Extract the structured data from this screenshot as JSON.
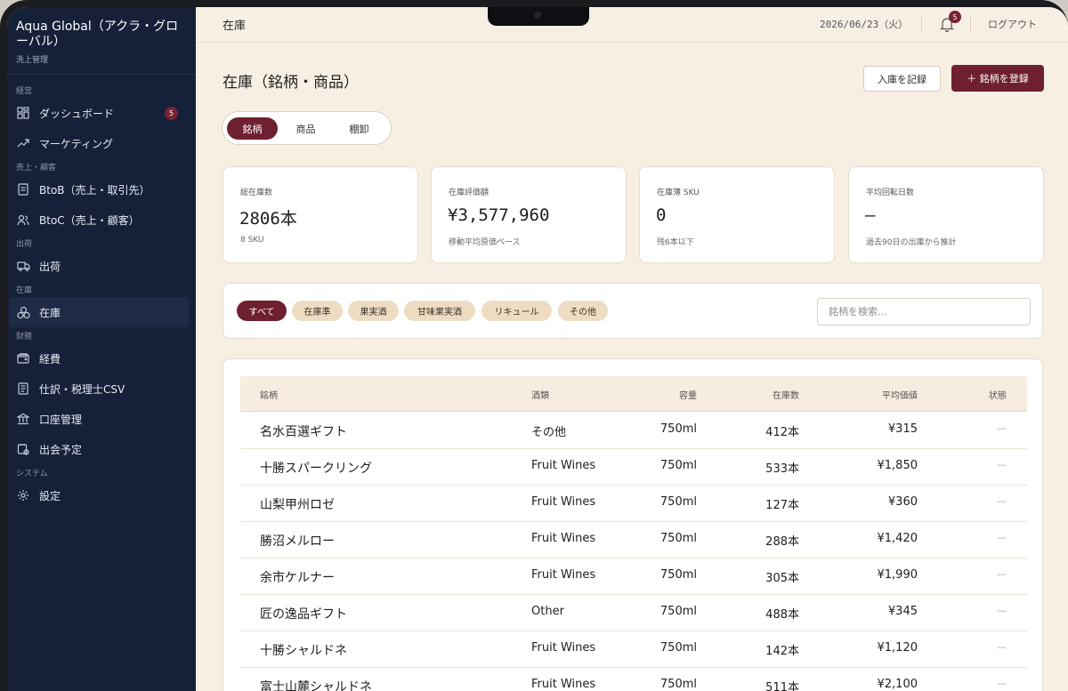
{
  "app": {
    "name": "Aqua Global（アクラ・グローバル）",
    "subtitle": "洗上管理"
  },
  "sidebar": {
    "sections": [
      {
        "label": "経営",
        "items": [
          {
            "label": "ダッシュボード",
            "icon": "grid-icon",
            "badge": "5"
          },
          {
            "label": "マーケティング",
            "icon": "trend-icon"
          }
        ]
      },
      {
        "label": "売上・顧客",
        "items": [
          {
            "label": "BtoB（売上・取引先）",
            "icon": "document-icon"
          },
          {
            "label": "BtoC（売上・顧客）",
            "icon": "users-icon"
          }
        ]
      },
      {
        "label": "出荷",
        "items": [
          {
            "label": "出荷",
            "icon": "truck-icon"
          }
        ]
      },
      {
        "label": "在庫",
        "items": [
          {
            "label": "在庫",
            "icon": "boxes-icon",
            "active": true
          }
        ]
      },
      {
        "label": "財務",
        "items": [
          {
            "label": "経費",
            "icon": "wallet-icon"
          },
          {
            "label": "仕訳・税理士CSV",
            "icon": "ledger-icon"
          },
          {
            "label": "口座管理",
            "icon": "bank-icon"
          },
          {
            "label": "出会予定",
            "icon": "calendar-check-icon"
          }
        ]
      },
      {
        "label": "システム",
        "items": [
          {
            "label": "設定",
            "icon": "gear-icon"
          }
        ]
      }
    ]
  },
  "header": {
    "title": "在庫",
    "date": "2026/06/23（火）",
    "notification_count": "5",
    "logout_label": "ログアウト"
  },
  "main": {
    "title": "在庫（銘柄・商品）",
    "record_button": "入庫を記録",
    "register_button": "＋ 銘柄を登録",
    "tabs": [
      "銘柄",
      "商品",
      "棚卸"
    ],
    "active_tab": "銘柄",
    "stats": [
      {
        "label": "総在庫数",
        "value": "2806本",
        "sub": "8 SKU"
      },
      {
        "label": "在庫評価額",
        "value": "¥3,577,960",
        "sub": "移動平均原価ベース"
      },
      {
        "label": "在庫薄 SKU",
        "value": "0",
        "sub": "残6本以下"
      },
      {
        "label": "平均回転日数",
        "value": "—",
        "sub": "過去90日の出庫から推計"
      }
    ],
    "filters": [
      "すべて",
      "在庫準",
      "果実酒",
      "甘味果実酒",
      "リキュール",
      "その他"
    ],
    "active_filter": "すべて",
    "search_placeholder": "銘柄を検索…",
    "table": {
      "columns": [
        "銘柄",
        "酒類",
        "容量",
        "在庫数",
        "平均価値",
        "状態"
      ],
      "rows": [
        {
          "name": "名水百選ギフト",
          "type": "その他",
          "volume": "750ml",
          "stock": "412本",
          "price": "¥315",
          "status": "—"
        },
        {
          "name": "十勝スパークリング",
          "type": "Fruit Wines",
          "volume": "750ml",
          "stock": "533本",
          "price": "¥1,850",
          "status": "—"
        },
        {
          "name": "山梨甲州ロゼ",
          "type": "Fruit Wines",
          "volume": "750ml",
          "stock": "127本",
          "price": "¥360",
          "status": "—"
        },
        {
          "name": "勝沼メルロー",
          "type": "Fruit Wines",
          "volume": "750ml",
          "stock": "288本",
          "price": "¥1,420",
          "status": "—"
        },
        {
          "name": "余市ケルナー",
          "type": "Fruit Wines",
          "volume": "750ml",
          "stock": "305本",
          "price": "¥1,990",
          "status": "—"
        },
        {
          "name": "匠の逸品ギフト",
          "type": "Other",
          "volume": "750ml",
          "stock": "488本",
          "price": "¥345",
          "status": "—"
        },
        {
          "name": "十勝シャルドネ",
          "type": "Fruit Wines",
          "volume": "750ml",
          "stock": "142本",
          "price": "¥1,120",
          "status": "—"
        },
        {
          "name": "富士山麓シャルドネ",
          "type": "Fruit Wines",
          "volume": "750ml",
          "stock": "511本",
          "price": "¥2,100",
          "status": "—"
        }
      ]
    }
  },
  "colors": {
    "accent": "#6e1f30",
    "sidebar_bg": "#162039",
    "page_bg": "#f8efe4",
    "chip_bg": "#eedcc2"
  }
}
